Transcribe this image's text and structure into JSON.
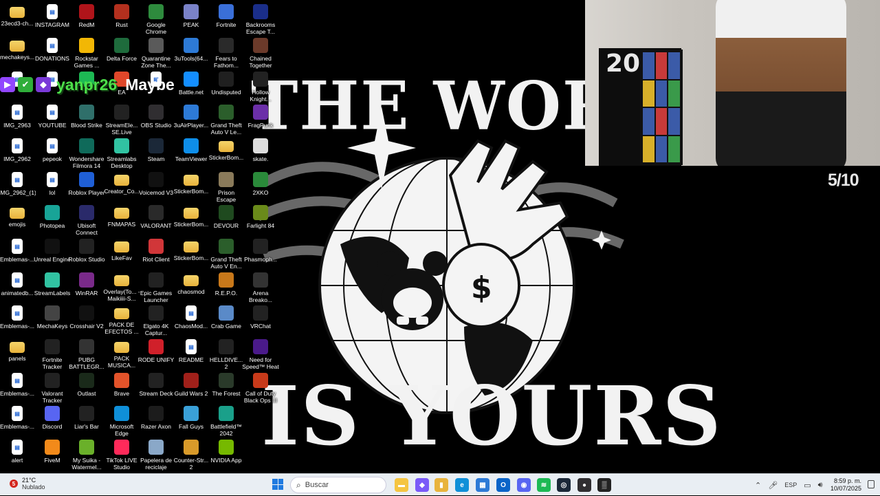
{
  "desktop": {
    "icons": [
      {
        "label": "23ecd3-ch...",
        "icon": "folder-icon",
        "color": "#e8b33c"
      },
      {
        "label": "INSTAGRAM",
        "icon": "file-icon",
        "color": "#ffffff"
      },
      {
        "label": "RedM",
        "icon": "redm-icon",
        "color": "#b0141a"
      },
      {
        "label": "Rust",
        "icon": "rust-icon",
        "color": "#b3301e"
      },
      {
        "label": "Google Chrome",
        "icon": "chrome-icon",
        "color": "#2e8b3d"
      },
      {
        "label": "PEAK",
        "icon": "peak-icon",
        "color": "#7a82c8"
      },
      {
        "label": "Fortnite",
        "icon": "fortnite-icon",
        "color": "#3a6fd8"
      },
      {
        "label": "Backrooms Escape T...",
        "icon": "backrooms-icon",
        "color": "#1a2e8a"
      },
      {
        "label": "mechakeys...",
        "icon": "folder-icon",
        "color": "#e8b33c"
      },
      {
        "label": "DONATIONS",
        "icon": "file-icon",
        "color": "#ffffff"
      },
      {
        "label": "Rockstar Games ...",
        "icon": "rockstar-icon",
        "color": "#f2b705"
      },
      {
        "label": "Delta Force",
        "icon": "deltaforce-icon",
        "color": "#1e6b3c"
      },
      {
        "label": "Quarantine Zone The...",
        "icon": "quarantine-icon",
        "color": "#5a5a5a"
      },
      {
        "label": "3uTools(64...",
        "icon": "3utools-icon",
        "color": "#2d7ad6"
      },
      {
        "label": "Fears to Fathom...",
        "icon": "fears-icon",
        "color": "#2a2a2a"
      },
      {
        "label": "Chained Together",
        "icon": "chained-icon",
        "color": "#6b3a2a"
      },
      {
        "label": "",
        "icon": "file-icon",
        "color": "#ffffff"
      },
      {
        "label": "",
        "icon": "file-icon",
        "color": "#ffffff"
      },
      {
        "label": "",
        "icon": "spotify-icon",
        "color": "#1db954"
      },
      {
        "label": "EA",
        "icon": "ea-icon",
        "color": "#e0472a"
      },
      {
        "label": "",
        "icon": "file-icon",
        "color": "#ffffff"
      },
      {
        "label": "Battle.net",
        "icon": "battlenet-icon",
        "color": "#148eff"
      },
      {
        "label": "Undisputed",
        "icon": "undisputed-icon",
        "color": "#202020"
      },
      {
        "label": "Hollow Knight...",
        "icon": "hollowknight-icon",
        "color": "#222"
      },
      {
        "label": "IMG_2963",
        "icon": "file-icon",
        "color": "#ffffff"
      },
      {
        "label": "YOUTUBE",
        "icon": "file-icon",
        "color": "#ffffff"
      },
      {
        "label": "Blood Strike",
        "icon": "bloodstrike-icon",
        "color": "#2f6f6a"
      },
      {
        "label": "StreamEle... SE.Live",
        "icon": "streamelements-icon",
        "color": "#222"
      },
      {
        "label": "OBS Studio",
        "icon": "obs-icon",
        "color": "#302e31"
      },
      {
        "label": "3uAirPlayer...",
        "icon": "3uairplayer-icon",
        "color": "#2d7ad6"
      },
      {
        "label": "Grand Theft Auto V Le...",
        "icon": "gta-icon",
        "color": "#2b5e2b"
      },
      {
        "label": "FragPunk",
        "icon": "fragpunk-icon",
        "color": "#6b2fa8"
      },
      {
        "label": "IMG_2962",
        "icon": "file-icon",
        "color": "#ffffff"
      },
      {
        "label": "pepeok",
        "icon": "file-icon",
        "color": "#ffffff"
      },
      {
        "label": "Wondershare Filmora 14",
        "icon": "filmora-icon",
        "color": "#0f6a5a"
      },
      {
        "label": "Streamlabs Desktop",
        "icon": "streamlabs-icon",
        "color": "#31c3a2"
      },
      {
        "label": "Steam",
        "icon": "steam-icon",
        "color": "#1b2838"
      },
      {
        "label": "TeamViewer",
        "icon": "teamviewer-icon",
        "color": "#0e8ee9"
      },
      {
        "label": "StickerBom...",
        "icon": "folder-icon",
        "color": "#e8b33c"
      },
      {
        "label": "skate.",
        "icon": "skate-icon",
        "color": "#dddddd"
      },
      {
        "label": "IMG_2962_(1)",
        "icon": "file-icon",
        "color": "#ffffff"
      },
      {
        "label": "lol",
        "icon": "file-icon",
        "color": "#ffffff"
      },
      {
        "label": "Roblox Player",
        "icon": "roblox-icon",
        "color": "#1f5fd6"
      },
      {
        "label": "Creator_Co...",
        "icon": "folder-icon",
        "color": "#e8b33c"
      },
      {
        "label": "Voicemod V3",
        "icon": "voicemod-icon",
        "color": "#111"
      },
      {
        "label": "StickerBom...",
        "icon": "folder-icon",
        "color": "#e8b33c"
      },
      {
        "label": "Prison Escape Simulator D...",
        "icon": "prisonescape-icon",
        "color": "#8a7a5a"
      },
      {
        "label": "2XKO",
        "icon": "2xko-icon",
        "color": "#2a8a3a"
      },
      {
        "label": "emojis",
        "icon": "folder-icon",
        "color": "#e8b33c"
      },
      {
        "label": "Photopea",
        "icon": "photopea-icon",
        "color": "#18a497"
      },
      {
        "label": "Ubisoft Connect",
        "icon": "ubisoft-icon",
        "color": "#2a2a6a"
      },
      {
        "label": "FNMAPAS",
        "icon": "folder-icon",
        "color": "#e8b33c"
      },
      {
        "label": "VALORANT",
        "icon": "valorant-icon",
        "color": "#2a2a2a"
      },
      {
        "label": "StickerBom...",
        "icon": "folder-icon",
        "color": "#e8b33c"
      },
      {
        "label": "DEVOUR",
        "icon": "devour-icon",
        "color": "#1f4a1f"
      },
      {
        "label": "Farlight 84",
        "icon": "farlight-icon",
        "color": "#6a8a1a"
      },
      {
        "label": "Emblemas-...",
        "icon": "file-icon",
        "color": "#ffffff"
      },
      {
        "label": "Unreal Engine",
        "icon": "unreal-icon",
        "color": "#111"
      },
      {
        "label": "Roblox Studio",
        "icon": "robloxstudio-icon",
        "color": "#222"
      },
      {
        "label": "LikeFav",
        "icon": "folder-icon",
        "color": "#e8b33c"
      },
      {
        "label": "Riot Client",
        "icon": "riot-icon",
        "color": "#d13639"
      },
      {
        "label": "StickerBom...",
        "icon": "folder-icon",
        "color": "#e8b33c"
      },
      {
        "label": "Grand Theft Auto V En...",
        "icon": "gta-icon",
        "color": "#2b5e2b"
      },
      {
        "label": "Phasmoph...",
        "icon": "phasmophobia-icon",
        "color": "#222"
      },
      {
        "label": "animatedb...",
        "icon": "file-icon",
        "color": "#ffffff"
      },
      {
        "label": "StreamLabels",
        "icon": "streamlabels-icon",
        "color": "#31c3a2"
      },
      {
        "label": "WinRAR",
        "icon": "winrar-icon",
        "color": "#7a2a8a"
      },
      {
        "label": "Overlay(To... - Maikiiii-S...",
        "icon": "folder-icon",
        "color": "#e8b33c"
      },
      {
        "label": "Epic Games Launcher",
        "icon": "epic-icon",
        "color": "#222"
      },
      {
        "label": "chaosmod",
        "icon": "folder-icon",
        "color": "#e8b33c"
      },
      {
        "label": "R.E.P.O.",
        "icon": "repo-icon",
        "color": "#c8781a"
      },
      {
        "label": "Arena Breako...",
        "icon": "arena-icon",
        "color": "#333"
      },
      {
        "label": "Emblemas-...",
        "icon": "file-icon",
        "color": "#ffffff"
      },
      {
        "label": "MechaKeys",
        "icon": "mechakeys-icon",
        "color": "#444"
      },
      {
        "label": "Crosshair V2",
        "icon": "crosshair-icon",
        "color": "#111"
      },
      {
        "label": "PACK DE EFECTOS ...",
        "icon": "folder-icon",
        "color": "#e8b33c"
      },
      {
        "label": "Elgato 4K Captur...",
        "icon": "elgato-icon",
        "color": "#222"
      },
      {
        "label": "ChaosMod...",
        "icon": "file-icon",
        "color": "#ffffff"
      },
      {
        "label": "Crab Game",
        "icon": "crabgame-icon",
        "color": "#5a8ac8"
      },
      {
        "label": "VRChat",
        "icon": "vrchat-icon",
        "color": "#222"
      },
      {
        "label": "panels",
        "icon": "folder-icon",
        "color": "#e8b33c"
      },
      {
        "label": "Fortnite Tracker",
        "icon": "fortnitetracker-icon",
        "color": "#222"
      },
      {
        "label": "PUBG BATTLEGR...",
        "icon": "pubg-icon",
        "color": "#333"
      },
      {
        "label": "PACK MUSICA...",
        "icon": "folder-icon",
        "color": "#e8b33c"
      },
      {
        "label": "RODE UNIFY",
        "icon": "rode-icon",
        "color": "#d0202a"
      },
      {
        "label": "README",
        "icon": "file-icon",
        "color": "#ffffff"
      },
      {
        "label": "HELLDIVE... 2",
        "icon": "helldivers-icon",
        "color": "#222"
      },
      {
        "label": "Need for Speed™ Heat",
        "icon": "nfs-icon",
        "color": "#4a1a8a"
      },
      {
        "label": "Emblemas-...",
        "icon": "file-icon",
        "color": "#ffffff"
      },
      {
        "label": "Valorant Tracker",
        "icon": "valoranttracker-icon",
        "color": "#222"
      },
      {
        "label": "Outlast",
        "icon": "outlast-icon",
        "color": "#1a2a1a"
      },
      {
        "label": "Brave",
        "icon": "brave-icon",
        "color": "#e2532a"
      },
      {
        "label": "Stream Deck",
        "icon": "streamdeck-icon",
        "color": "#222"
      },
      {
        "label": "Guild Wars 2",
        "icon": "guildwars-icon",
        "color": "#a0201a"
      },
      {
        "label": "The Forest",
        "icon": "theforest-icon",
        "color": "#2a3a2a"
      },
      {
        "label": "Call of Duty Black Ops III",
        "icon": "cod-icon",
        "color": "#c83a1a"
      },
      {
        "label": "Emblemas-...",
        "icon": "file-icon",
        "color": "#ffffff"
      },
      {
        "label": "Discord",
        "icon": "discord-icon",
        "color": "#5865f2"
      },
      {
        "label": "Liar's Bar",
        "icon": "liarsbar-icon",
        "color": "#222"
      },
      {
        "label": "Microsoft Edge",
        "icon": "edge-icon",
        "color": "#0f8fd8"
      },
      {
        "label": "Razer Axon",
        "icon": "razer-icon",
        "color": "#1c1c1c"
      },
      {
        "label": "Fall Guys",
        "icon": "fallguys-icon",
        "color": "#3aa0d8"
      },
      {
        "label": "Battlefield™ 2042",
        "icon": "battlefield-icon",
        "color": "#1aa08a"
      },
      {
        "label": "",
        "icon": "blank",
        "color": "#000000"
      },
      {
        "label": "alert",
        "icon": "file-icon",
        "color": "#ffffff"
      },
      {
        "label": "FiveM",
        "icon": "fivem-icon",
        "color": "#f28a1a"
      },
      {
        "label": "My Suika - Watermel...",
        "icon": "suika-icon",
        "color": "#6ab02a"
      },
      {
        "label": "TikTok LIVE Studio",
        "icon": "tiktok-icon",
        "color": "#ff2a5a"
      },
      {
        "label": "Papelera de reciclaje",
        "icon": "recycle-bin-icon",
        "color": "#8aa8c8"
      },
      {
        "label": "Counter-Str... 2",
        "icon": "cs2-icon",
        "color": "#d89a2a"
      },
      {
        "label": "NVIDIA App",
        "icon": "nvidia-icon",
        "color": "#76b900"
      },
      {
        "label": "",
        "icon": "blank",
        "color": "#000000"
      }
    ]
  },
  "overlay": {
    "username": "yanpr26",
    "song": "Maybe"
  },
  "wallpaper": {
    "top_text": "THE WORL",
    "bottom_text": "IS YOURS"
  },
  "webcam": {
    "jersey_number": "20",
    "counter": "5/10"
  },
  "taskbar": {
    "weather": {
      "badge": "5",
      "temp": "21°C",
      "condition": "Nublado"
    },
    "search_placeholder": "Buscar",
    "apps": [
      {
        "name": "file-explorer-app",
        "color": "#f5c542",
        "glyph": "▬"
      },
      {
        "name": "copilot-app",
        "color": "#7a5af8",
        "glyph": "◆"
      },
      {
        "name": "folder-app",
        "color": "#e8b33c",
        "glyph": "▮"
      },
      {
        "name": "edge-app",
        "color": "#0f8fd8",
        "glyph": "e"
      },
      {
        "name": "store-app",
        "color": "#2d7ad6",
        "glyph": "▦"
      },
      {
        "name": "outlook-app",
        "color": "#0a64c8",
        "glyph": "O"
      },
      {
        "name": "discord-app",
        "color": "#5865f2",
        "glyph": "◉"
      },
      {
        "name": "spotify-app",
        "color": "#1db954",
        "glyph": "≋"
      },
      {
        "name": "steam-app",
        "color": "#1b2838",
        "glyph": "◎"
      },
      {
        "name": "obs-app",
        "color": "#302e31",
        "glyph": "●"
      },
      {
        "name": "streamdeck-app",
        "color": "#222",
        "glyph": "▒"
      }
    ],
    "language": "ESP",
    "time": "8:59 p. m.",
    "date": "10/07/2025"
  }
}
